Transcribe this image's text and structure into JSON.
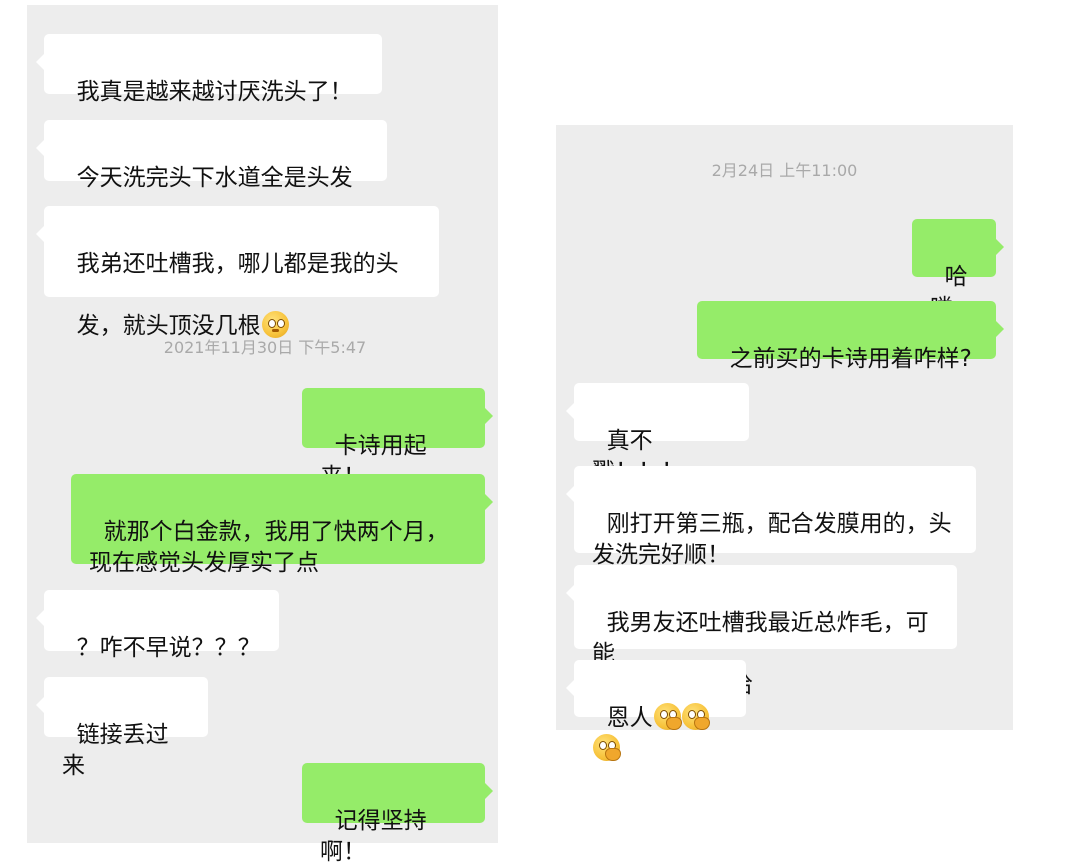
{
  "left_panel": {
    "messages": [
      {
        "id": "l1",
        "side": "in",
        "text": "我真是越来越讨厌洗头了！"
      },
      {
        "id": "l2",
        "side": "in",
        "text": "今天洗完头下水道全是头发"
      },
      {
        "id": "l3",
        "side": "in",
        "text_line1": "我弟还吐槽我，哪儿都是我的头",
        "text_line2": "发，就头顶没几根",
        "emoji": "flushed-face-emoji"
      },
      {
        "id": "l4",
        "side": "out",
        "text": "卡诗用起来！"
      },
      {
        "id": "l5",
        "side": "out",
        "text": "就那个白金款，我用了快两个月，\n现在感觉头发厚实了点"
      },
      {
        "id": "l6",
        "side": "in",
        "text": "？咋不早说？？？"
      },
      {
        "id": "l7",
        "side": "in",
        "text": "链接丢过来"
      },
      {
        "id": "l8",
        "side": "out",
        "text": "记得坚持啊！"
      }
    ],
    "timestamp": "2021年11月30日 下午5:47"
  },
  "right_panel": {
    "timestamp": "2月24日 上午11:00",
    "messages": [
      {
        "id": "r1",
        "side": "out",
        "text": "哈喽"
      },
      {
        "id": "r2",
        "side": "out",
        "text": "之前买的卡诗用着咋样?"
      },
      {
        "id": "r3",
        "side": "in",
        "text": "真不戳！！！"
      },
      {
        "id": "r4",
        "side": "in",
        "text": "刚打开第三瓶，配合发膜用的，头\n发洗完好顺！"
      },
      {
        "id": "r5",
        "side": "in",
        "text": "我男友还吐槽我最近总炸毛，可能\n是头发多了哈哈"
      },
      {
        "id": "r6",
        "side": "in",
        "text": "恩人",
        "emojis": [
          "thinking-face-emoji",
          "thinking-face-emoji",
          "thinking-face-emoji"
        ]
      }
    ]
  },
  "colors": {
    "background": "#ededed",
    "incoming_bubble": "#ffffff",
    "outgoing_bubble": "#95ec69",
    "timestamp_text": "#a9a9a9"
  }
}
